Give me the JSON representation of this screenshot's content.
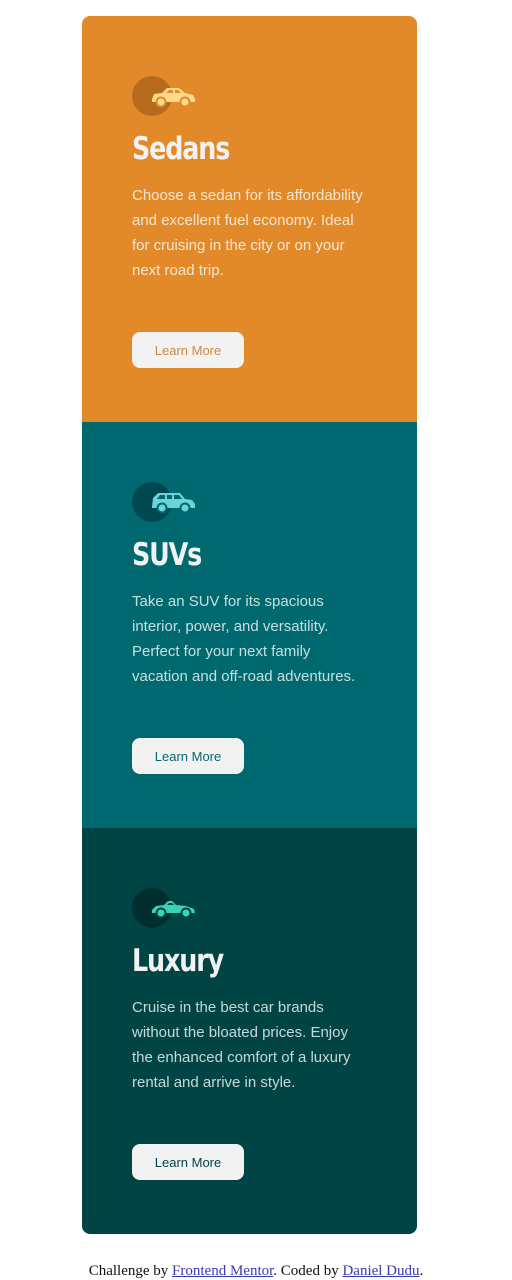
{
  "colors": {
    "sedans_bg": "#e28a2a",
    "suvs_bg": "#006970",
    "luxury_bg": "#004544",
    "button_bg": "#f2f2f2"
  },
  "cards": [
    {
      "title": "Sedans",
      "icon": "sedan-car-icon",
      "text": "Choose a sedan for its affordability and excellent fuel economy. Ideal for cruising in the city or on your next road trip.",
      "button_label": "Learn More"
    },
    {
      "title": "SUVs",
      "icon": "suv-car-icon",
      "text": "Take an SUV for its spacious interior, power, and versatility. Perfect for your next family vacation and off-road adventures.",
      "button_label": "Learn More"
    },
    {
      "title": "Luxury",
      "icon": "luxury-car-icon",
      "text": "Cruise in the best car brands without the bloated prices. Enjoy the enhanced comfort of a luxury rental and arrive in style.",
      "button_label": "Learn More"
    }
  ],
  "footer": {
    "prefix": "Challenge by ",
    "link1": "Frontend Mentor",
    "middle": ". Coded by ",
    "link2": "Daniel Dudu",
    "suffix": "."
  }
}
